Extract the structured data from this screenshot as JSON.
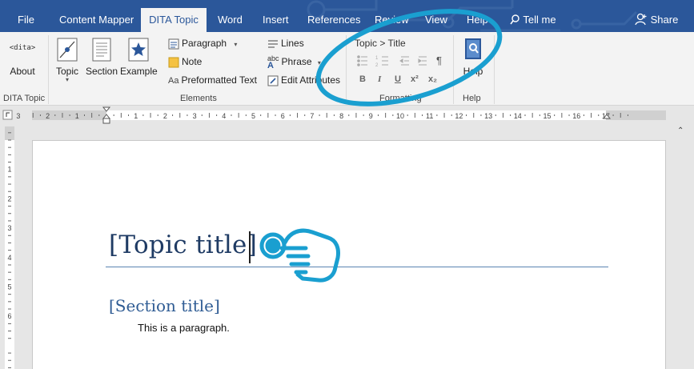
{
  "tabs": [
    "File",
    "Content Mapper",
    "DITA Topic",
    "Word",
    "Insert",
    "References",
    "Review",
    "View",
    "Help"
  ],
  "tell_me": "Tell me",
  "share": "Share",
  "ribbon": {
    "about_icon_text": "<dita>",
    "about": "About",
    "topic": "Topic",
    "section": "Section",
    "example": "Example",
    "paragraph": "Paragraph",
    "note": "Note",
    "preformatted": "Preformatted Text",
    "lines": "Lines",
    "phrase": "Phrase",
    "phrase_icon": "abc",
    "edit_attributes": "Edit Attributes",
    "breadcrumb": "Topic > Title",
    "fmt_bold": "B",
    "fmt_italic": "I",
    "fmt_underline": "U",
    "fmt_superscript": "x²",
    "fmt_subscript": "x₂",
    "fmt_pilcrow": "¶",
    "help": "Help",
    "groups": {
      "dita_topic": "DITA Topic",
      "elements": "Elements",
      "formatting": "Formatting",
      "help": "Help"
    }
  },
  "ruler_numbers": [
    "3",
    "2",
    "1",
    "1",
    "2",
    "3",
    "4",
    "5",
    "6",
    "7",
    "8",
    "9",
    "10",
    "11",
    "12",
    "13",
    "14",
    "15",
    "16",
    "17"
  ],
  "vruler_numbers": [
    "1",
    "1",
    "2",
    "3",
    "4",
    "5",
    "6"
  ],
  "document": {
    "topic_title": "[Topic title]",
    "section_title": "[Section title]",
    "paragraph": "This is a paragraph."
  },
  "colors": {
    "tab_bar": "#2b579a",
    "highlight": "#1a9fd0",
    "title_text": "#1f3b64"
  }
}
